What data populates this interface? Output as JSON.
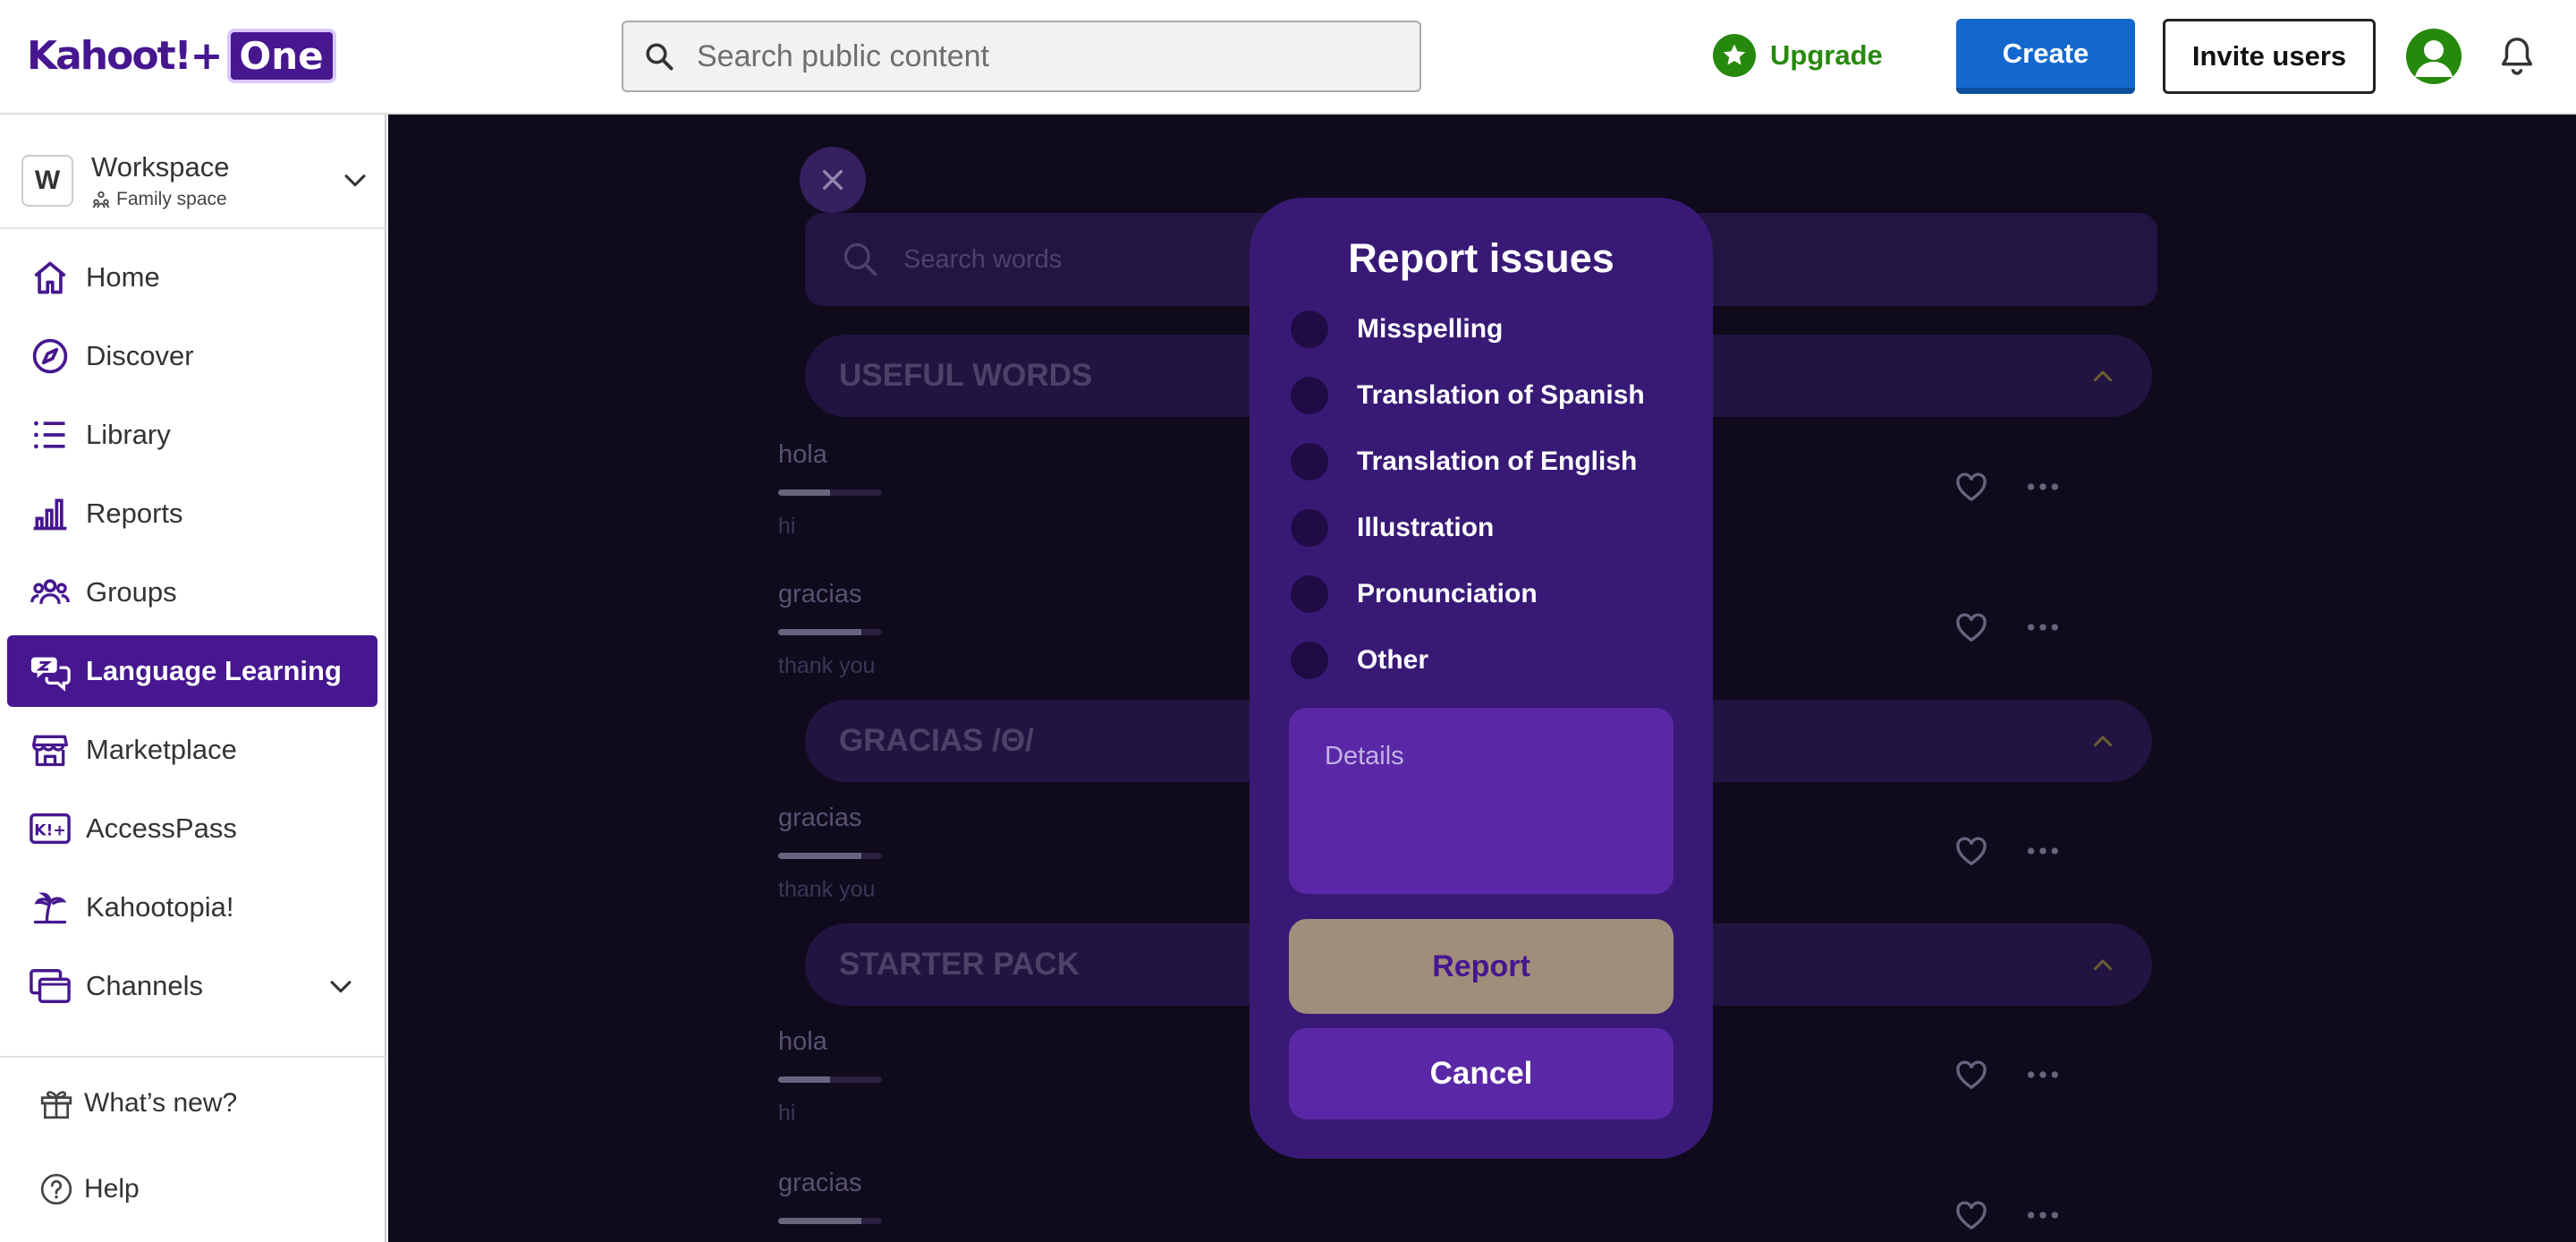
{
  "header": {
    "logo_text": "Kahoot!+",
    "logo_badge": "One",
    "search_placeholder": "Search public content",
    "upgrade_label": "Upgrade",
    "create_label": "Create",
    "invite_label": "Invite users"
  },
  "sidebar": {
    "workspace_initial": "W",
    "workspace_title": "Workspace",
    "workspace_sub": "Family space",
    "items": [
      {
        "label": "Home",
        "icon": "home-icon"
      },
      {
        "label": "Discover",
        "icon": "compass-icon"
      },
      {
        "label": "Library",
        "icon": "list-icon"
      },
      {
        "label": "Reports",
        "icon": "bar-chart-icon"
      },
      {
        "label": "Groups",
        "icon": "groups-icon"
      },
      {
        "label": "Language Learning",
        "icon": "language-icon",
        "active": true
      },
      {
        "label": "Marketplace",
        "icon": "store-icon"
      },
      {
        "label": "AccessPass",
        "icon": "accesspass-icon"
      },
      {
        "label": "Kahootopia!",
        "icon": "island-icon"
      },
      {
        "label": "Channels",
        "icon": "channels-icon"
      }
    ],
    "whats_new": "What’s new?",
    "help": "Help"
  },
  "main": {
    "search_placeholder": "Search words",
    "sections": [
      {
        "title": "USEFUL WORDS"
      },
      {
        "title": "GRACIAS /Θ/"
      },
      {
        "title": "STARTER PACK"
      }
    ],
    "words": [
      {
        "es": "hola",
        "en": "hi",
        "progress": 0.5
      },
      {
        "es": "gracias",
        "en": "thank you",
        "progress": 0.8
      },
      {
        "es": "gracias",
        "en": "thank you",
        "progress": 0.8
      },
      {
        "es": "hola",
        "en": "hi",
        "progress": 0.5
      },
      {
        "es": "gracias",
        "en": "",
        "progress": 0.8
      }
    ]
  },
  "modal": {
    "title": "Report issues",
    "options": [
      "Misspelling",
      "Translation of Spanish",
      "Translation of English",
      "Illustration",
      "Pronunciation",
      "Other"
    ],
    "details_placeholder": "Details",
    "report_label": "Report",
    "cancel_label": "Cancel"
  },
  "colors": {
    "brand_purple": "#46178f",
    "create_blue": "#1368ce",
    "upgrade_green": "#26890c",
    "modal_bg": "#381a76",
    "report_button": "#a18e7a"
  }
}
